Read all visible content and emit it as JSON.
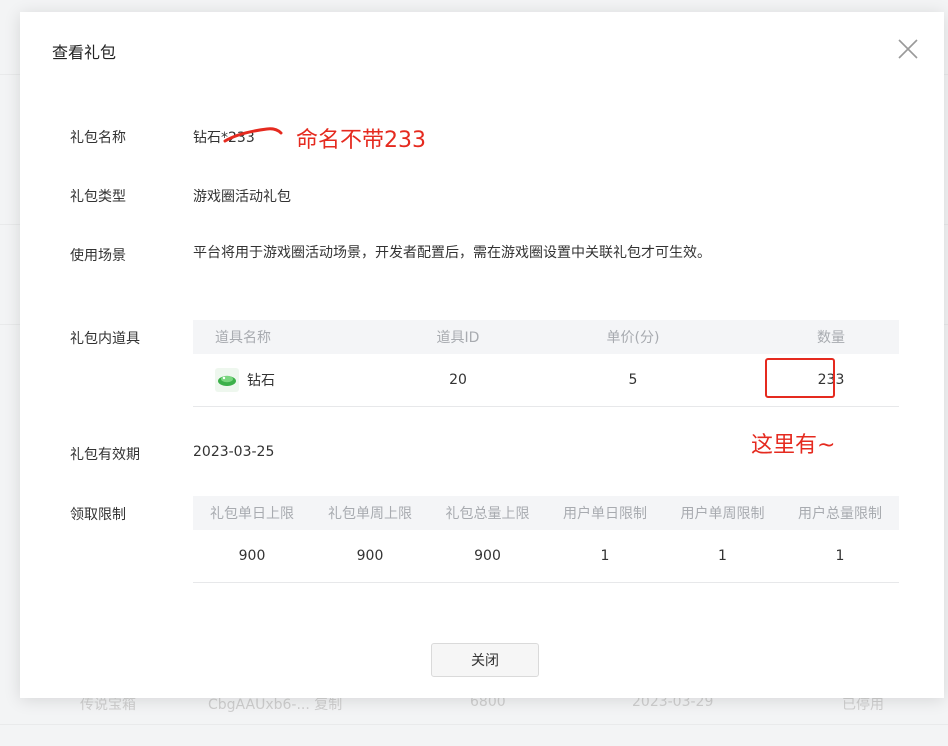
{
  "dialog": {
    "title": "查看礼包",
    "close_button": "关闭",
    "close_icon": "close-icon"
  },
  "fields": {
    "name_label": "礼包名称",
    "name_value": "钻石*233",
    "type_label": "礼包类型",
    "type_value": "游戏圈活动礼包",
    "scene_label": "使用场景",
    "scene_value": "平台将用于游戏圈活动场景，开发者配置后，需在游戏圈设置中关联礼包才可生效。",
    "items_label": "礼包内道具",
    "validity_label": "礼包有效期",
    "validity_value": "2023-03-25",
    "limit_label": "领取限制"
  },
  "items_table": {
    "headers": [
      "道具名称",
      "道具ID",
      "单价(分)",
      "数量"
    ],
    "rows": [
      {
        "name": "钻石",
        "icon": "gem-icon",
        "id": "20",
        "price": "5",
        "qty": "233"
      }
    ]
  },
  "limits_table": {
    "headers": [
      "礼包单日上限",
      "礼包单周上限",
      "礼包总量上限",
      "用户单日限制",
      "用户单周限制",
      "用户总量限制"
    ],
    "values": [
      "900",
      "900",
      "900",
      "1",
      "1",
      "1"
    ]
  },
  "annotations": {
    "name_note": "命名不带233",
    "qty_note": "这里有~",
    "color": "#e52a1f"
  },
  "background": {
    "row_partial": [
      "传说宝箱",
      "CbgAAUxb6-... 复制",
      "6800",
      "2023-03-29",
      "已停用"
    ]
  }
}
